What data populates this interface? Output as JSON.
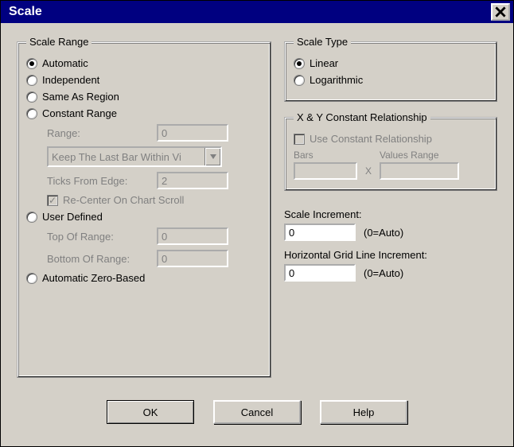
{
  "window": {
    "title": "Scale"
  },
  "scale_range": {
    "legend": "Scale Range",
    "automatic": "Automatic",
    "independent": "Independent",
    "same_as_region": "Same As Region",
    "constant_range": "Constant Range",
    "range_label": "Range:",
    "range_value": "0",
    "dropdown_value": "Keep The Last Bar Within Vi",
    "ticks_label": "Ticks From Edge:",
    "ticks_value": "2",
    "recenter_label": "Re-Center On Chart Scroll",
    "user_defined": "User Defined",
    "top_label": "Top Of Range:",
    "top_value": "0",
    "bottom_label": "Bottom Of Range:",
    "bottom_value": "0",
    "auto_zero": "Automatic Zero-Based",
    "selected": "automatic"
  },
  "scale_type": {
    "legend": "Scale Type",
    "linear": "Linear",
    "logarithmic": "Logarithmic",
    "selected": "linear"
  },
  "xy": {
    "legend": "X & Y Constant Relationship",
    "use_label": "Use Constant Relationship",
    "bars_label": "Bars",
    "bars_value": "",
    "x": "X",
    "values_range_label": "Values Range",
    "values_range_value": ""
  },
  "scale_increment": {
    "label": "Scale Increment:",
    "value": "0",
    "hint": "(0=Auto)"
  },
  "hgrid": {
    "label": "Horizontal Grid Line Increment:",
    "value": "0",
    "hint": "(0=Auto)"
  },
  "buttons": {
    "ok": "OK",
    "cancel": "Cancel",
    "help": "Help"
  }
}
